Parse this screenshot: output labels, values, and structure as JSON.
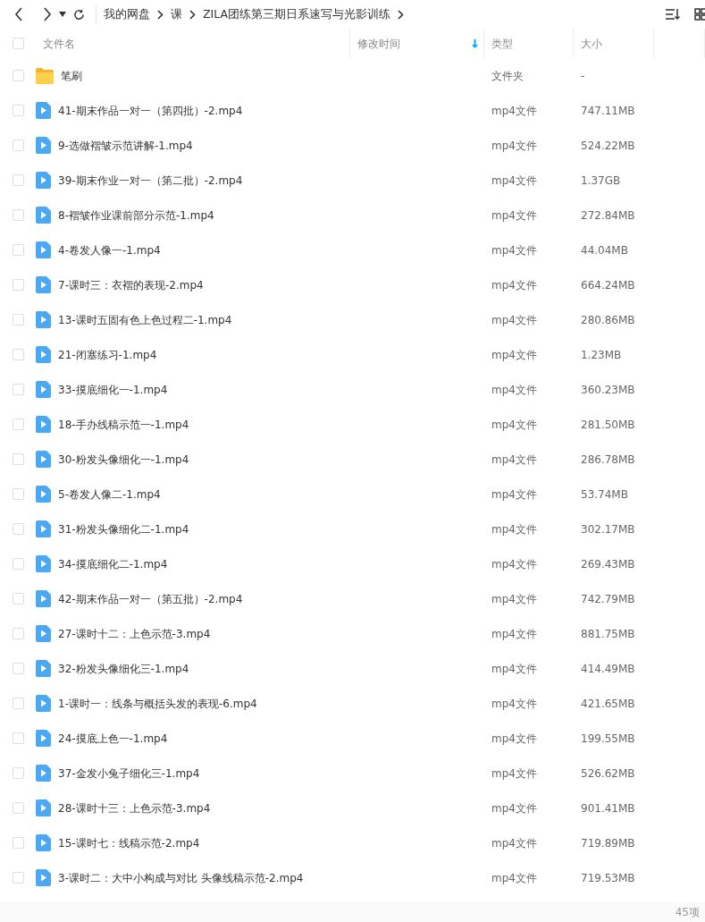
{
  "toolbar": {
    "breadcrumb": [
      "我的网盘",
      "课",
      "ZILA团练第三期日系速写与光影训练"
    ]
  },
  "table": {
    "all_checked": false,
    "columns": [
      {
        "label": "文件名",
        "sorted": false
      },
      {
        "label": "修改时间",
        "sorted": true
      },
      {
        "label": "类型",
        "sorted": false
      },
      {
        "label": "大小",
        "sorted": false
      }
    ],
    "rows": [
      {
        "kind": "folder",
        "name": "笔刷",
        "type": "文件夹",
        "size": "-",
        "checked": false
      },
      {
        "kind": "video",
        "name": "41-期末作品一对一（第四批）-2.mp4",
        "type": "mp4文件",
        "size": "747.11MB",
        "checked": false
      },
      {
        "kind": "video",
        "name": "9-选做褶皱示范讲解-1.mp4",
        "type": "mp4文件",
        "size": "524.22MB",
        "checked": false
      },
      {
        "kind": "video",
        "name": "39-期末作业一对一（第二批）-2.mp4",
        "type": "mp4文件",
        "size": "1.37GB",
        "checked": false
      },
      {
        "kind": "video",
        "name": "8-褶皱作业课前部分示范-1.mp4",
        "type": "mp4文件",
        "size": "272.84MB",
        "checked": false
      },
      {
        "kind": "video",
        "name": "4-卷发人像一-1.mp4",
        "type": "mp4文件",
        "size": "44.04MB",
        "checked": false
      },
      {
        "kind": "video",
        "name": "7-课时三：衣褶的表现-2.mp4",
        "type": "mp4文件",
        "size": "664.24MB",
        "checked": false
      },
      {
        "kind": "video",
        "name": "13-课时五固有色上色过程二-1.mp4",
        "type": "mp4文件",
        "size": "280.86MB",
        "checked": false
      },
      {
        "kind": "video",
        "name": "21-闭塞练习-1.mp4",
        "type": "mp4文件",
        "size": "1.23MB",
        "checked": false
      },
      {
        "kind": "video",
        "name": "33-摸底细化一-1.mp4",
        "type": "mp4文件",
        "size": "360.23MB",
        "checked": false
      },
      {
        "kind": "video",
        "name": "18-手办线稿示范一-1.mp4",
        "type": "mp4文件",
        "size": "281.50MB",
        "checked": false
      },
      {
        "kind": "video",
        "name": "30-粉发头像细化一-1.mp4",
        "type": "mp4文件",
        "size": "286.78MB",
        "checked": false
      },
      {
        "kind": "video",
        "name": "5-卷发人像二-1.mp4",
        "type": "mp4文件",
        "size": "53.74MB",
        "checked": false
      },
      {
        "kind": "video",
        "name": "31-粉发头像细化二-1.mp4",
        "type": "mp4文件",
        "size": "302.17MB",
        "checked": false
      },
      {
        "kind": "video",
        "name": "34-摸底细化二-1.mp4",
        "type": "mp4文件",
        "size": "269.43MB",
        "checked": false
      },
      {
        "kind": "video",
        "name": "42-期末作品一对一（第五批）-2.mp4",
        "type": "mp4文件",
        "size": "742.79MB",
        "checked": false
      },
      {
        "kind": "video",
        "name": "27-课时十二：上色示范-3.mp4",
        "type": "mp4文件",
        "size": "881.75MB",
        "checked": false
      },
      {
        "kind": "video",
        "name": "32-粉发头像细化三-1.mp4",
        "type": "mp4文件",
        "size": "414.49MB",
        "checked": false
      },
      {
        "kind": "video",
        "name": "1-课时一：线条与概括头发的表现-6.mp4",
        "type": "mp4文件",
        "size": "421.65MB",
        "checked": false
      },
      {
        "kind": "video",
        "name": "24-摸底上色一-1.mp4",
        "type": "mp4文件",
        "size": "199.55MB",
        "checked": false
      },
      {
        "kind": "video",
        "name": "37-金发小兔子细化三-1.mp4",
        "type": "mp4文件",
        "size": "526.62MB",
        "checked": false
      },
      {
        "kind": "video",
        "name": "28-课时十三：上色示范-3.mp4",
        "type": "mp4文件",
        "size": "901.41MB",
        "checked": false
      },
      {
        "kind": "video",
        "name": "15-课时七：线稿示范-2.mp4",
        "type": "mp4文件",
        "size": "719.89MB",
        "checked": false
      },
      {
        "kind": "video",
        "name": "3-课时二：大中小构成与对比 头像线稿示范-2.mp4",
        "type": "mp4文件",
        "size": "719.53MB",
        "checked": false
      }
    ]
  },
  "status_bar": {
    "count": "45项"
  }
}
